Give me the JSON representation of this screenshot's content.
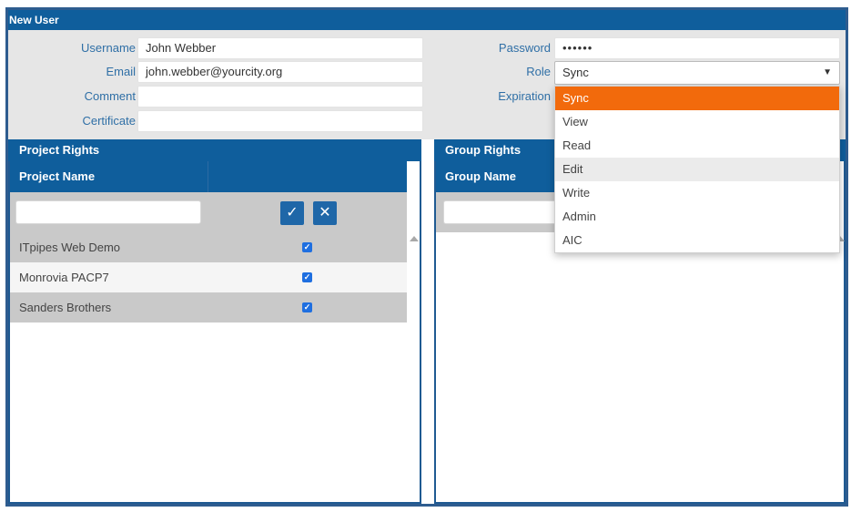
{
  "window": {
    "title": "New User"
  },
  "form": {
    "username_label": "Username",
    "username_value": "John Webber",
    "email_label": "Email",
    "email_value": "john.webber@yourcity.org",
    "comment_label": "Comment",
    "comment_value": "",
    "certificate_label": "Certificate",
    "certificate_value": "",
    "password_label": "Password",
    "password_value": "••••••",
    "role_label": "Role",
    "role_value": "Sync",
    "expiration_label": "Expiration"
  },
  "role_dropdown": {
    "options": [
      "Sync",
      "View",
      "Read",
      "Edit",
      "Write",
      "Admin",
      "AIC"
    ],
    "selected": "Sync",
    "hovered": "Edit"
  },
  "project_rights": {
    "title": "Project Rights",
    "column_name": "Project Name",
    "rows": [
      {
        "name": "ITpipes Web Demo",
        "checked": true
      },
      {
        "name": "Monrovia PACP7",
        "checked": true
      },
      {
        "name": "Sanders Brothers",
        "checked": true
      }
    ]
  },
  "group_rights": {
    "title": "Group Rights",
    "column_name": "Group Name"
  },
  "colors": {
    "header_blue": "#0f5e9c",
    "accent_orange": "#f26a0c",
    "label_blue": "#2f6fa6",
    "checkbox_blue": "#1f6fe0"
  },
  "icons": {
    "confirm": "check-icon",
    "cancel": "close-icon",
    "scroll": "scroll-up-arrow-icon",
    "select": "caret-down-icon"
  }
}
